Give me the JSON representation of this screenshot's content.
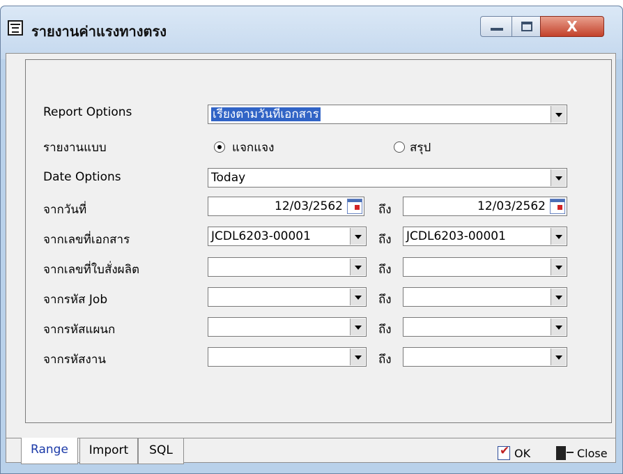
{
  "window": {
    "title": "รายงานค่าแรงทางตรง",
    "close_glyph": "X"
  },
  "form": {
    "report_options": {
      "label": "Report Options",
      "value": "เรียงตามวันที่เอกสาร"
    },
    "report_type": {
      "label": "รายงานแบบ",
      "option_detail": "แจกแจง",
      "option_summary": "สรุป",
      "selected": "แจกแจง"
    },
    "date_options": {
      "label": "Date Options",
      "value": "Today"
    },
    "date_range": {
      "label": "จากวันที่",
      "from": "12/03/2562",
      "to": "12/03/2562"
    },
    "doc_no": {
      "label": "จากเลขที่เอกสาร",
      "from": "JCDL6203-00001",
      "to": "JCDL6203-00001"
    },
    "production_order": {
      "label": "จากเลขที่ใบสั่งผลิต",
      "from": "",
      "to": ""
    },
    "job_code": {
      "label": "จากรหัส Job",
      "from": "",
      "to": ""
    },
    "dept_code": {
      "label": "จากรหัสแผนก",
      "from": "",
      "to": ""
    },
    "work_code": {
      "label": "จากรหัสงาน",
      "from": "",
      "to": ""
    },
    "to_label": "ถึง"
  },
  "tabs": [
    {
      "label": "Range",
      "active": true
    },
    {
      "label": "Import",
      "active": false
    },
    {
      "label": "SQL",
      "active": false
    }
  ],
  "actions": {
    "ok_label": "OK",
    "close_label": "Close"
  },
  "colors": {
    "title_bar": "#c4d8ee",
    "close_button": "#c3412a",
    "selection": "#3164c6",
    "active_tab_text": "#1b3aa8"
  }
}
